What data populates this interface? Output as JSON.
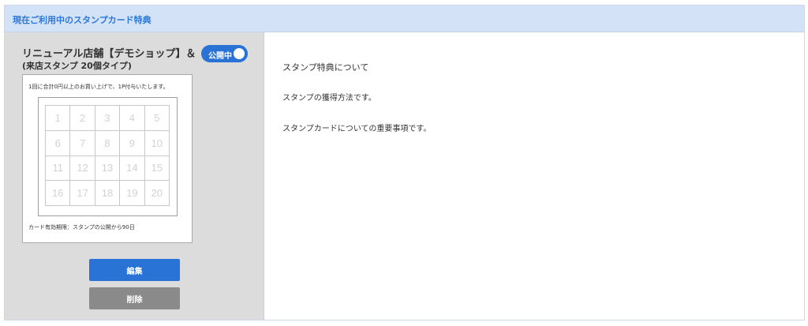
{
  "header": {
    "title": "現在ご利用中のスタンプカード特典"
  },
  "card": {
    "title": "リニューアル店舗【デモショップ】＆　＆",
    "subtitle": "(来店スタンプ 20個タイプ)",
    "status_label": "公開中",
    "note": "1回に合計0円以上のお買い上げで、1P付与いたします。",
    "stamps": [
      "1",
      "2",
      "3",
      "4",
      "5",
      "6",
      "7",
      "8",
      "9",
      "10",
      "11",
      "12",
      "13",
      "14",
      "15",
      "16",
      "17",
      "18",
      "19",
      "20"
    ],
    "expiry": "カード有効期限：スタンプの公開から90日"
  },
  "actions": {
    "edit_label": "編集",
    "delete_label": "削除"
  },
  "info": {
    "line1": "スタンプ特典について",
    "line2": "スタンプの獲得方法です。",
    "line3": "スタンプカードについての重要事項です。"
  },
  "colors": {
    "accent": "#2a73d6",
    "header_bg": "#d3e2f7",
    "left_bg": "#dcdcdc",
    "delete_bg": "#8a8a8a"
  }
}
